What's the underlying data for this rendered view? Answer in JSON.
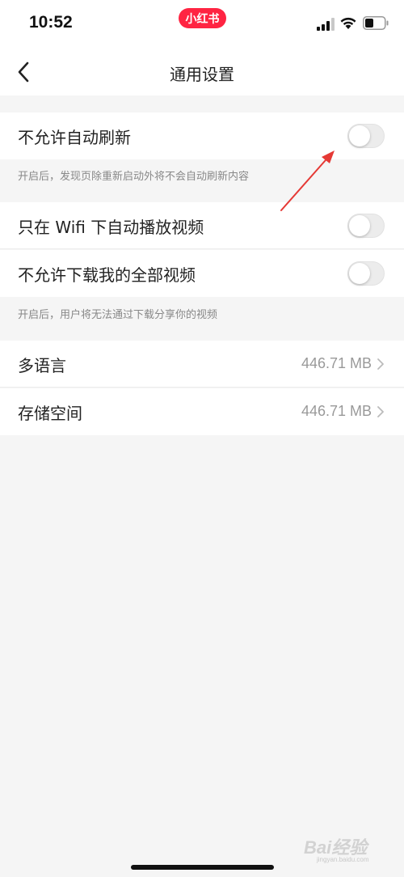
{
  "status_bar": {
    "time": "10:52",
    "app_badge": "小红书"
  },
  "nav": {
    "title": "通用设置"
  },
  "settings": {
    "auto_refresh": {
      "label": "不允许自动刷新",
      "enabled": false,
      "hint": "开启后，发现页除重新启动外将不会自动刷新内容"
    },
    "wifi_autoplay": {
      "label": "只在 Wifi 下自动播放视频",
      "enabled": false
    },
    "disallow_download": {
      "label": "不允许下载我的全部视频",
      "enabled": false,
      "hint": "开启后，用户将无法通过下载分享你的视频"
    },
    "language": {
      "label": "多语言",
      "value": "446.71 MB"
    },
    "storage": {
      "label": "存储空间",
      "value": "446.71 MB"
    }
  },
  "watermark": {
    "text": "Bai经验",
    "sub": "jingyan.baidu.com"
  },
  "colors": {
    "brand": "#ff2442",
    "annotation_arrow": "#e53935",
    "toggle_off": "#ececec"
  }
}
